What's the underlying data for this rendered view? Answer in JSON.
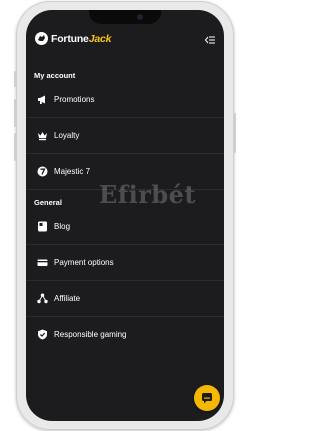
{
  "brand": {
    "name_primary": "Fortune",
    "name_accent": "Jack"
  },
  "colors": {
    "accent": "#f5c518",
    "background": "#1c1c1e",
    "text": "#ffffff"
  },
  "header": {
    "collapse_icon": "collapse-menu-icon"
  },
  "sections": [
    {
      "title": "My account",
      "items": [
        {
          "label": "Promotions",
          "icon": "megaphone-icon"
        },
        {
          "label": "Loyalty",
          "icon": "crown-icon"
        },
        {
          "label": "Majestic 7",
          "icon": "number-seven-icon"
        }
      ]
    },
    {
      "title": "General",
      "items": [
        {
          "label": "Blog",
          "icon": "blog-icon"
        },
        {
          "label": "Payment options",
          "icon": "card-icon"
        },
        {
          "label": "Affiliate",
          "icon": "network-icon"
        },
        {
          "label": "Responsible gaming",
          "icon": "shield-check-icon"
        }
      ]
    }
  ],
  "watermark": "Efirbét",
  "chat": {
    "icon": "chat-icon"
  }
}
